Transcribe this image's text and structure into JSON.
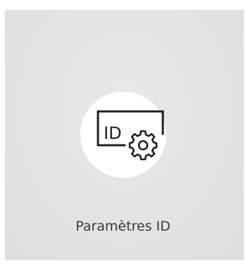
{
  "tile": {
    "label": "Paramètres ID",
    "icon": "id-settings-icon",
    "icon_text": "ID"
  },
  "colors": {
    "tile_background": "#e4e4e4",
    "icon_background": "#ffffff",
    "icon_stroke": "#1f1f1f",
    "label_text": "#3a3a3a"
  }
}
